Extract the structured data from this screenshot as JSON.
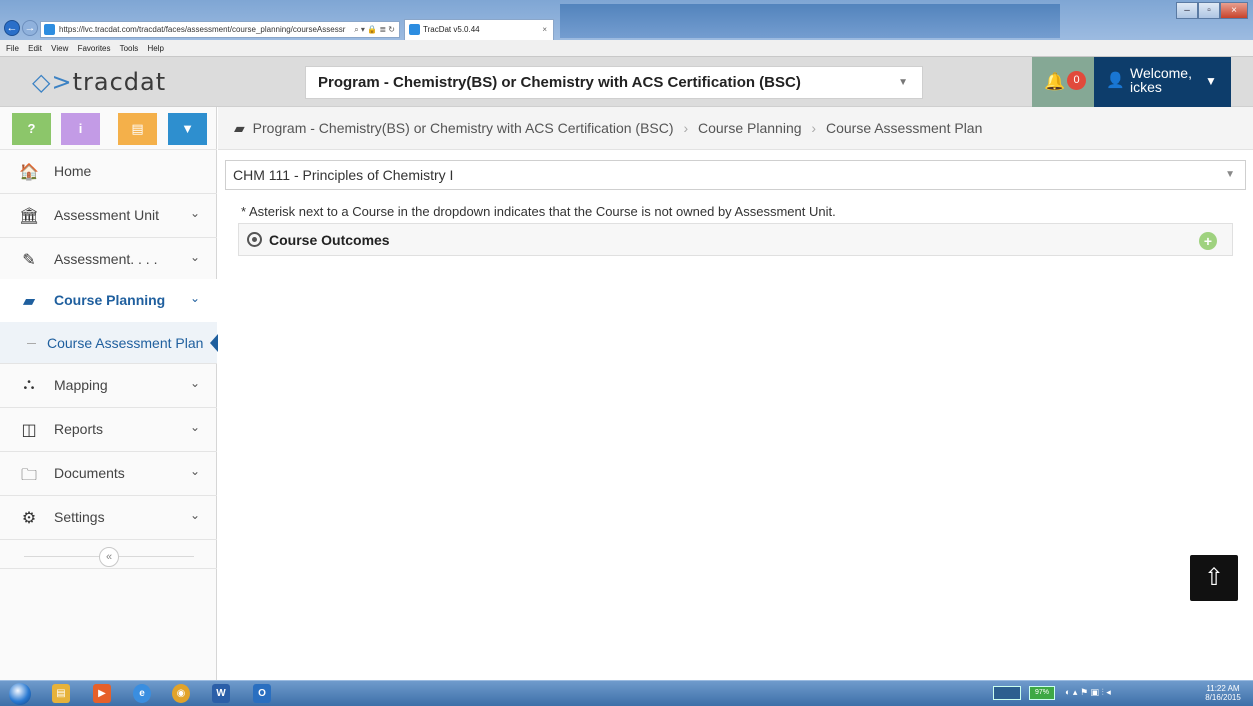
{
  "browser": {
    "url": "https://lvc.tracdat.com/tracdat/faces/assessment/course_planning/courseAssessr",
    "tab_title": "TracDat v5.0.44",
    "menu": [
      "File",
      "Edit",
      "View",
      "Favorites",
      "Tools",
      "Help"
    ]
  },
  "header": {
    "logo_text": "tracdat",
    "program_select": "Program - Chemistry(BS) or Chemistry with ACS Certification (BSC)",
    "notification_count": "0",
    "welcome": "Welcome,",
    "username": "ickes"
  },
  "sidebar": {
    "quick_buttons": [
      {
        "label": "?",
        "color": "#8cc66a"
      },
      {
        "label": "i",
        "color": "#c39be6"
      },
      {
        "label": "▤",
        "color": "#f4b04a"
      },
      {
        "label": "▼",
        "color": "#2e8fcf"
      }
    ],
    "items": [
      {
        "label": "Home",
        "icon": "home-icon"
      },
      {
        "label": "Assessment Unit",
        "icon": "institution-icon"
      },
      {
        "label": "Assessment. . . .",
        "icon": "pencil-icon"
      },
      {
        "label": "Course Planning",
        "icon": "book-icon"
      },
      {
        "label": "Mapping",
        "icon": "sitemap-icon"
      },
      {
        "label": "Reports",
        "icon": "columns-icon"
      },
      {
        "label": "Documents",
        "icon": "folder-icon"
      },
      {
        "label": "Settings",
        "icon": "gear-icon"
      }
    ],
    "sub_item": "Course Assessment Plan"
  },
  "breadcrumb": {
    "items": [
      "Program - Chemistry(BS) or Chemistry with ACS Certification (BSC)",
      "Course Planning",
      "Course Assessment Plan"
    ]
  },
  "main": {
    "course_select": "CHM 111 - Principles of Chemistry I",
    "note": "* Asterisk next to a Course in the dropdown indicates that the Course is not owned by Assessment Unit.",
    "outcomes_title": "Course Outcomes"
  },
  "taskbar": {
    "battery": "97%",
    "time": "11:22 AM",
    "date": "8/16/2015"
  },
  "colors": {
    "accent": "#1f5f9e",
    "user_bg": "#0d3d6b",
    "notif_bg": "#85a895",
    "badge": "#e14a3b"
  }
}
